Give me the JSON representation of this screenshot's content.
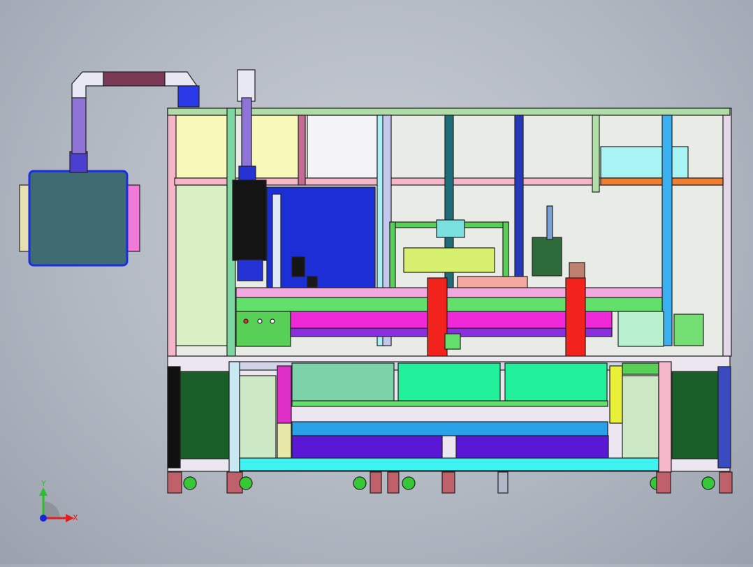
{
  "triad": {
    "x_label": "X",
    "y_label": "Y"
  },
  "colors": {
    "background": "#b8bec8",
    "frame_pink": "#f4b6c8",
    "frame_green": "#8fd18a",
    "dust_collector": "#3f6b72",
    "motor_black": "#141414",
    "panel_blue": "#1c2fd6",
    "carriage_magenta": "#f029d8",
    "guide_red": "#f2221d",
    "base_cyan": "#3ff2f2",
    "purple_tray": "#5a17d6"
  }
}
